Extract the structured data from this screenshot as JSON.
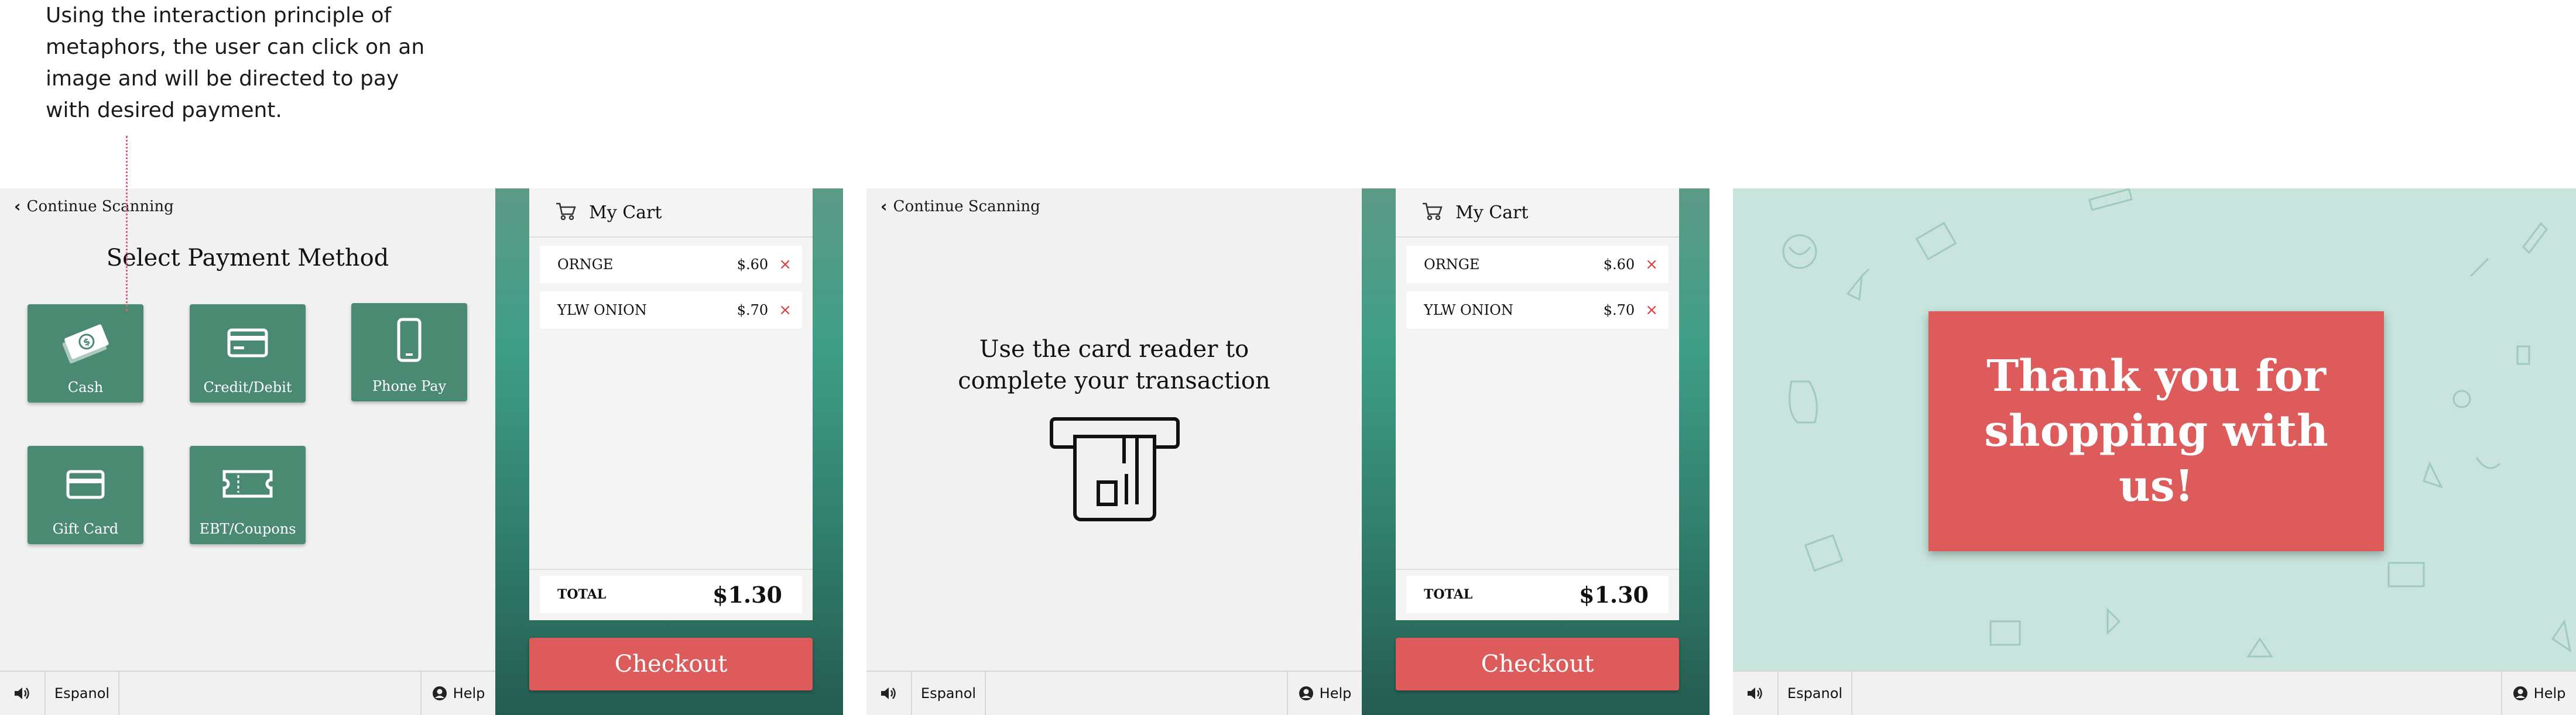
{
  "annotation": {
    "lines": [
      "Using the interaction principle of",
      "metaphors, the user can click on an",
      "image and will be directed to pay",
      "with desired payment."
    ]
  },
  "nav": {
    "continue_label": "Continue Scanning"
  },
  "payment": {
    "title": "Select Payment Method",
    "methods": [
      {
        "label": "Cash",
        "icon": "cash-icon"
      },
      {
        "label": "Credit/Debit",
        "icon": "credit-card-icon"
      },
      {
        "label": "Phone Pay",
        "icon": "phone-icon"
      },
      {
        "label": "Gift Card",
        "icon": "gift-card-icon"
      },
      {
        "label": "EBT/Coupons",
        "icon": "coupon-icon"
      }
    ]
  },
  "cart": {
    "title": "My Cart",
    "items": [
      {
        "name": "ORNGE",
        "price": "$.60"
      },
      {
        "name": "YLW ONION",
        "price": "$.70"
      }
    ],
    "remove_glyph": "×",
    "total_label": "TOTAL",
    "total_value": "$1.30",
    "checkout_label": "Checkout"
  },
  "card_screen": {
    "message_line1": "Use the card reader to",
    "message_line2": "complete your transaction"
  },
  "thanks": {
    "line1": "Thank you for",
    "line2": "shopping with us!"
  },
  "footer": {
    "language_label": "Espanol",
    "help_label": "Help"
  },
  "colors": {
    "primary_green": "#4a8a72",
    "accent_red": "#dd5b5b",
    "mint_bg": "#c8e4dd"
  }
}
